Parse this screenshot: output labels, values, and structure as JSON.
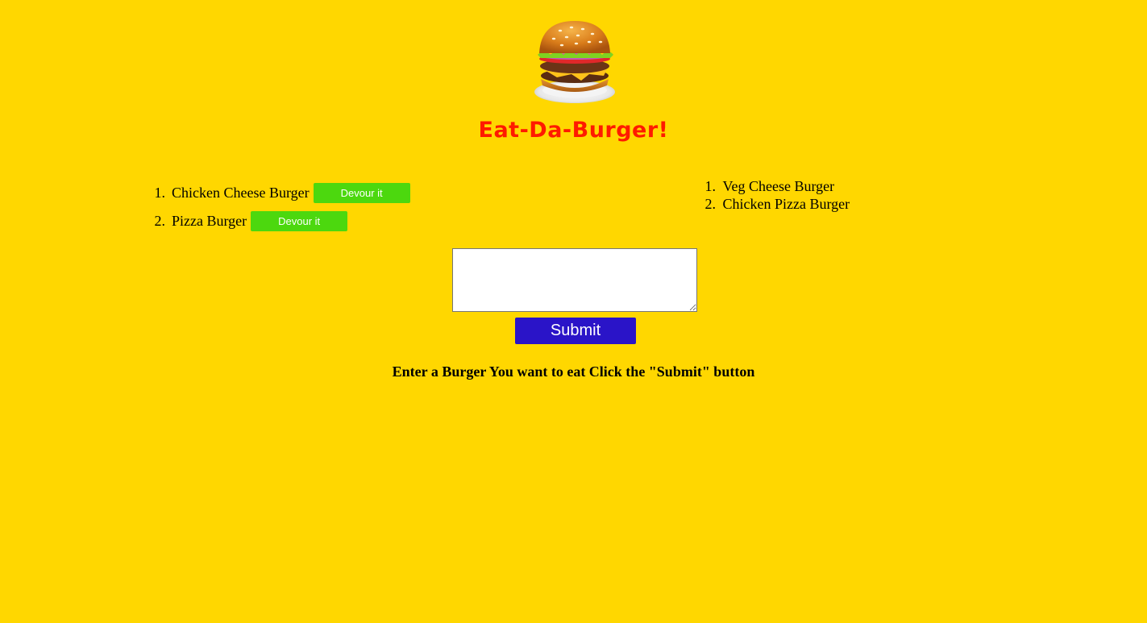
{
  "header": {
    "logo_icon": "hamburger-icon",
    "title": "Eat-Da-Burger!"
  },
  "colors": {
    "background": "#ffd700",
    "title": "#ff1a00",
    "devour_button": "#4cd80e",
    "submit_button": "#2a14c8"
  },
  "not_devoured": {
    "items": [
      {
        "number": "1.",
        "name": "Chicken Cheese Burger",
        "button_label": "Devour it"
      },
      {
        "number": "2.",
        "name": "Pizza Burger",
        "button_label": "Devour it"
      }
    ]
  },
  "devoured": {
    "items": [
      {
        "number": "1.",
        "name": "Veg Cheese Burger"
      },
      {
        "number": "2.",
        "name": "Chicken Pizza Burger"
      }
    ]
  },
  "form": {
    "input_value": "",
    "submit_label": "Submit",
    "instructions": "Enter a Burger You want to eat Click the \"Submit\" button"
  }
}
